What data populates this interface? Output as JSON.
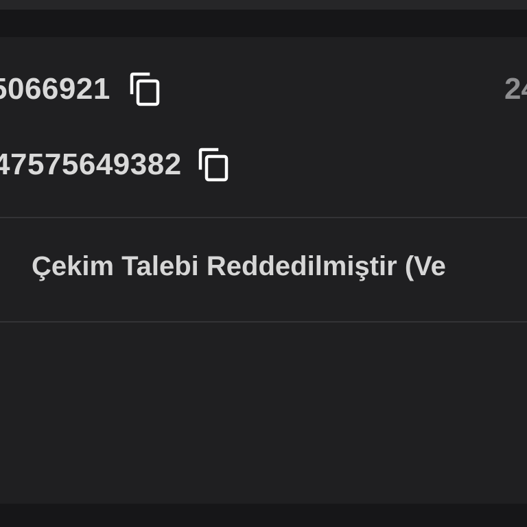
{
  "transaction": {
    "id_primary": "5066921",
    "id_secondary": "47575649382",
    "right_value": "24",
    "status_message": "Çekim Talebi Reddedilmiştir (Ve"
  },
  "icons": {
    "copy": "copy-icon"
  },
  "colors": {
    "background": "#1f1f21",
    "top_bar": "#161618",
    "text_primary": "#d9d9d9",
    "text_muted": "#8e8e90",
    "divider": "#333336",
    "icon": "#ffffff"
  }
}
